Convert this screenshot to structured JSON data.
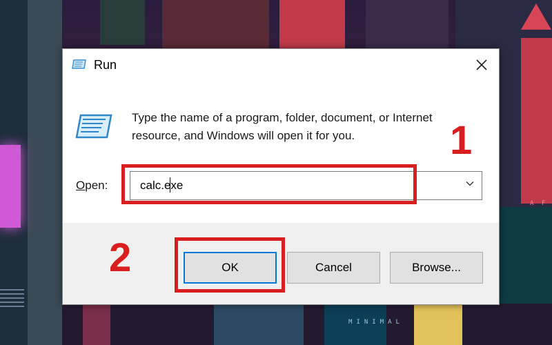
{
  "dialog": {
    "title": "Run",
    "close_symbol": "✕",
    "description": "Type the name of a program, folder, document, or Internet resource, and Windows will open it for you.",
    "open_label_prefix": "O",
    "open_label_rest": "pen:",
    "open_value": "calc.exe",
    "buttons": {
      "ok": "OK",
      "cancel": "Cancel",
      "browse": "Browse..."
    }
  },
  "annotations": {
    "step1": "1",
    "step2": "2",
    "color": "#d81e1e"
  },
  "wallpaper": {
    "minimal_text": "MINIMAL",
    "side_text": "A F"
  },
  "icons": {
    "run_small": "run-icon",
    "run_large": "run-icon",
    "close": "close-icon",
    "dropdown": "chevron-down-icon"
  }
}
